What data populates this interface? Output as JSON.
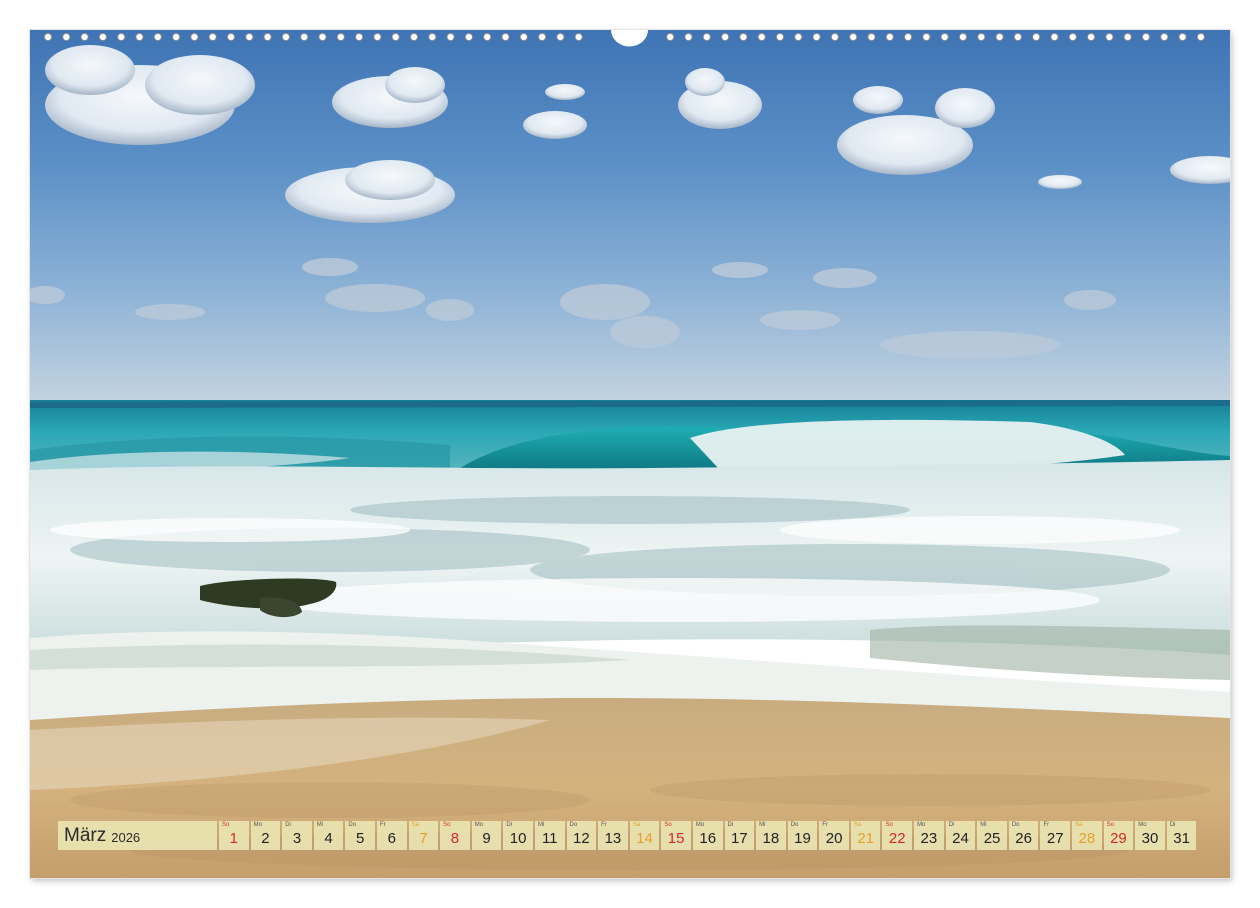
{
  "calendar": {
    "month": "März",
    "year": "2026",
    "days": [
      {
        "wd": "So",
        "d": "1",
        "type": "sun"
      },
      {
        "wd": "Mo",
        "d": "2",
        "type": "work"
      },
      {
        "wd": "Di",
        "d": "3",
        "type": "work"
      },
      {
        "wd": "Mi",
        "d": "4",
        "type": "work"
      },
      {
        "wd": "Do",
        "d": "5",
        "type": "work"
      },
      {
        "wd": "Fr",
        "d": "6",
        "type": "work"
      },
      {
        "wd": "Sa",
        "d": "7",
        "type": "sat"
      },
      {
        "wd": "So",
        "d": "8",
        "type": "sun"
      },
      {
        "wd": "Mo",
        "d": "9",
        "type": "work"
      },
      {
        "wd": "Di",
        "d": "10",
        "type": "work"
      },
      {
        "wd": "Mi",
        "d": "11",
        "type": "work"
      },
      {
        "wd": "Do",
        "d": "12",
        "type": "work"
      },
      {
        "wd": "Fr",
        "d": "13",
        "type": "work"
      },
      {
        "wd": "Sa",
        "d": "14",
        "type": "sat"
      },
      {
        "wd": "So",
        "d": "15",
        "type": "sun"
      },
      {
        "wd": "Mo",
        "d": "16",
        "type": "work"
      },
      {
        "wd": "Di",
        "d": "17",
        "type": "work"
      },
      {
        "wd": "Mi",
        "d": "18",
        "type": "work"
      },
      {
        "wd": "Do",
        "d": "19",
        "type": "work"
      },
      {
        "wd": "Fr",
        "d": "20",
        "type": "work"
      },
      {
        "wd": "Sa",
        "d": "21",
        "type": "sat"
      },
      {
        "wd": "So",
        "d": "22",
        "type": "sun"
      },
      {
        "wd": "Mo",
        "d": "23",
        "type": "work"
      },
      {
        "wd": "Di",
        "d": "24",
        "type": "work"
      },
      {
        "wd": "Mi",
        "d": "25",
        "type": "work"
      },
      {
        "wd": "Do",
        "d": "26",
        "type": "work"
      },
      {
        "wd": "Fr",
        "d": "27",
        "type": "work"
      },
      {
        "wd": "Sa",
        "d": "28",
        "type": "sat"
      },
      {
        "wd": "So",
        "d": "29",
        "type": "sun"
      },
      {
        "wd": "Mo",
        "d": "30",
        "type": "work"
      },
      {
        "wd": "Di",
        "d": "31",
        "type": "work"
      }
    ]
  },
  "colors": {
    "strip_bg": "#e8e4b2",
    "saturday": "#e6a12a",
    "sunday": "#d42a2a",
    "text": "#222222"
  }
}
